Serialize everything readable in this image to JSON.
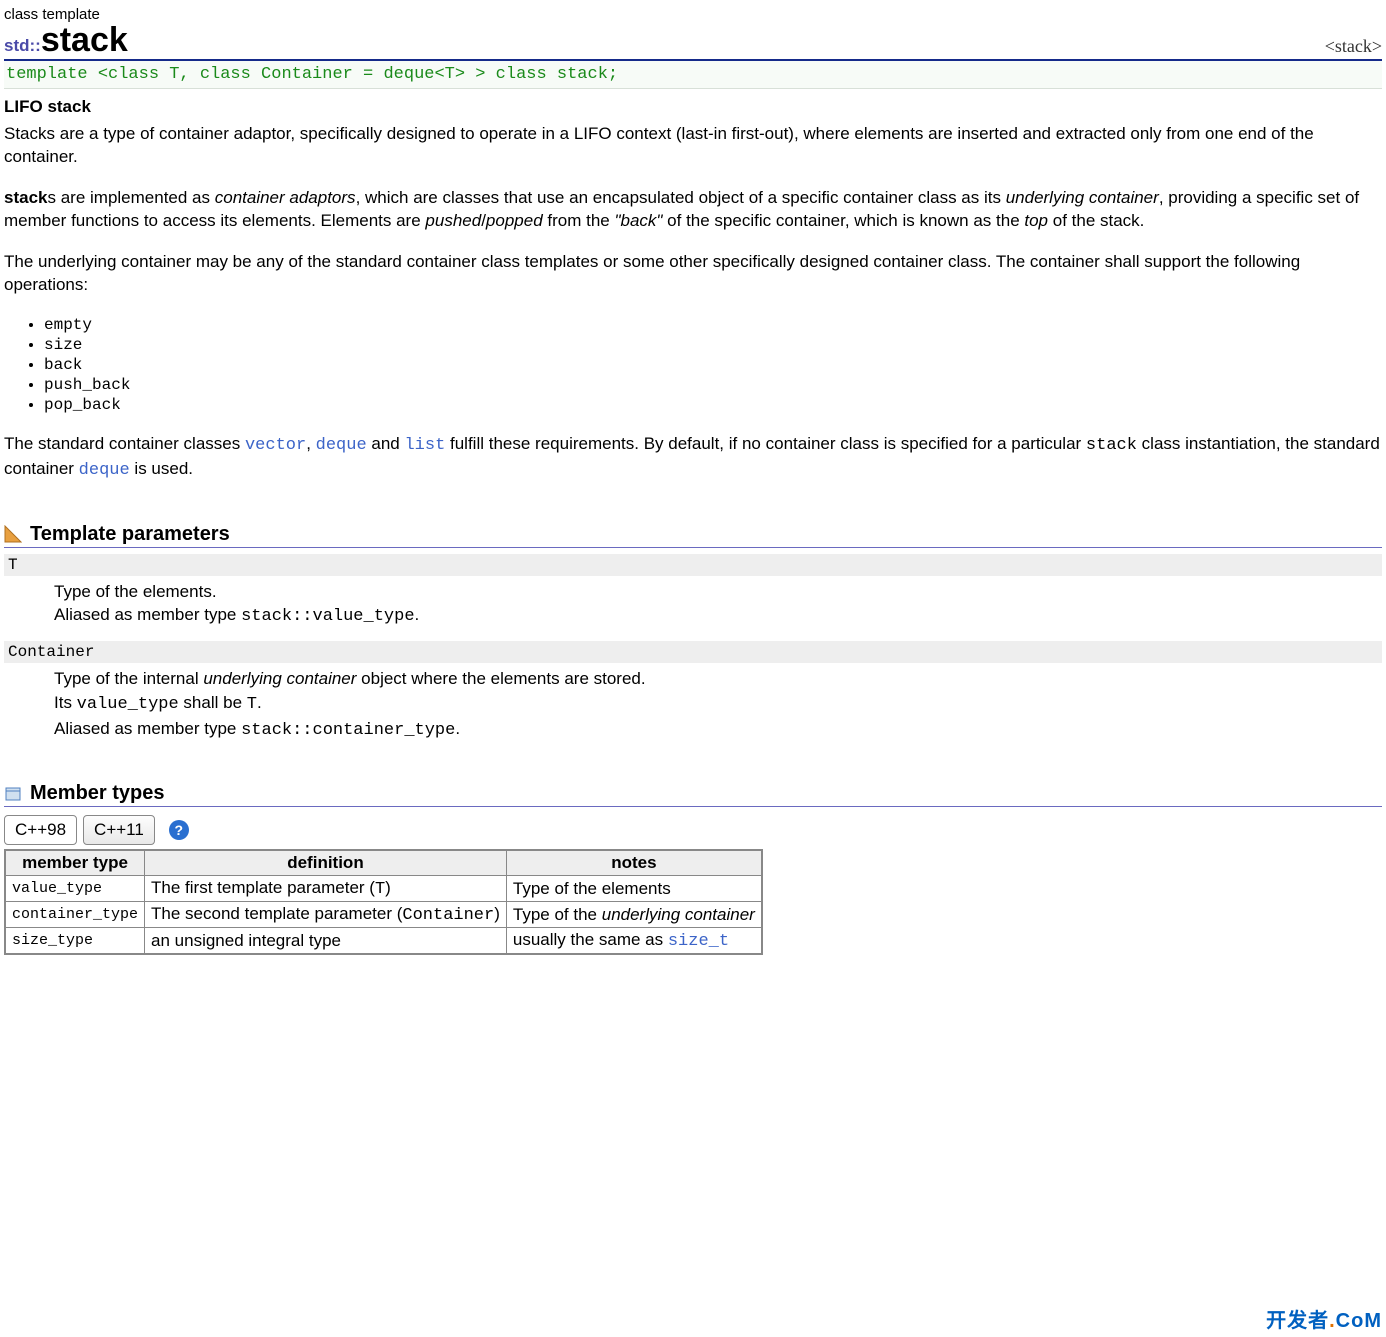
{
  "header": {
    "type_label": "class template",
    "namespace": "std::",
    "title": "stack",
    "include": "<stack>",
    "declaration": "template <class T, class Container = deque<T> > class stack;"
  },
  "intro": {
    "subtitle": "LIFO stack",
    "para1": "Stacks are a type of container adaptor, specifically designed to operate in a LIFO context (last-in first-out), where elements are inserted and extracted only from one end of the container.",
    "para2_pre_stack": "",
    "para2_stack": "stack",
    "para2_a": "s are implemented as ",
    "para2_em1": "container adaptors",
    "para2_b": ", which are classes that use an encapsulated object of a specific container class as its ",
    "para2_em2": "underlying container",
    "para2_c": ", providing a specific set of member functions to access its elements. Elements are ",
    "para2_em3": "pushed",
    "para2_slash": "/",
    "para2_em4": "popped",
    "para2_d": " from the ",
    "para2_em5": "\"back\"",
    "para2_e": " of the specific container, which is known as the ",
    "para2_em6": "top",
    "para2_f": " of the stack.",
    "para3": "The underlying container may be any of the standard container class templates or some other specifically designed container class. The container shall support the following operations:",
    "ops": [
      "empty",
      "size",
      "back",
      "push_back",
      "pop_back"
    ],
    "para4_a": "The standard container classes ",
    "para4_ref1": "vector",
    "para4_b": ", ",
    "para4_ref2": "deque",
    "para4_c": " and ",
    "para4_ref3": "list",
    "para4_d": " fulfill these requirements. By default, if no container class is specified for a particular ",
    "para4_mono": "stack",
    "para4_e": " class instantiation, the standard container ",
    "para4_ref4": "deque",
    "para4_f": " is used."
  },
  "sections": {
    "tpl_params_title": "Template parameters",
    "member_types_title": "Member types"
  },
  "tpl_params": [
    {
      "name": "T",
      "desc_lines": [
        {
          "text": "Type of the elements."
        },
        {
          "pre": "Aliased as member type ",
          "mono": "stack::value_type",
          "post": "."
        }
      ]
    },
    {
      "name": "Container",
      "desc_lines": [
        {
          "pre": "Type of the internal ",
          "em": "underlying container",
          "post": " object where the elements are stored."
        },
        {
          "pre": "Its ",
          "mono": "value_type",
          "mid": " shall be ",
          "mono2": "T",
          "post2": "."
        },
        {
          "pre": "Aliased as member type ",
          "mono": "stack::container_type",
          "post": "."
        }
      ]
    }
  ],
  "tabs": {
    "items": [
      "C++98",
      "C++11"
    ],
    "help": "?"
  },
  "member_types_table": {
    "headers": [
      "member type",
      "definition",
      "notes"
    ],
    "rows": [
      {
        "name": "value_type",
        "def_pre": "The first template parameter (",
        "def_mono": "T",
        "def_post": ")",
        "notes_plain": "Type of the elements"
      },
      {
        "name": "container_type",
        "def_pre": "The second template parameter (",
        "def_mono": "Container",
        "def_post": ")",
        "notes_pre": "Type of the ",
        "notes_em": "underlying container"
      },
      {
        "name": "size_type",
        "def_plain": "an unsigned integral type",
        "notes_pre": "usually the same as ",
        "notes_link": "size_t"
      }
    ]
  },
  "watermark": {
    "a": "开发者",
    "b": ".",
    "c": "CoM"
  }
}
